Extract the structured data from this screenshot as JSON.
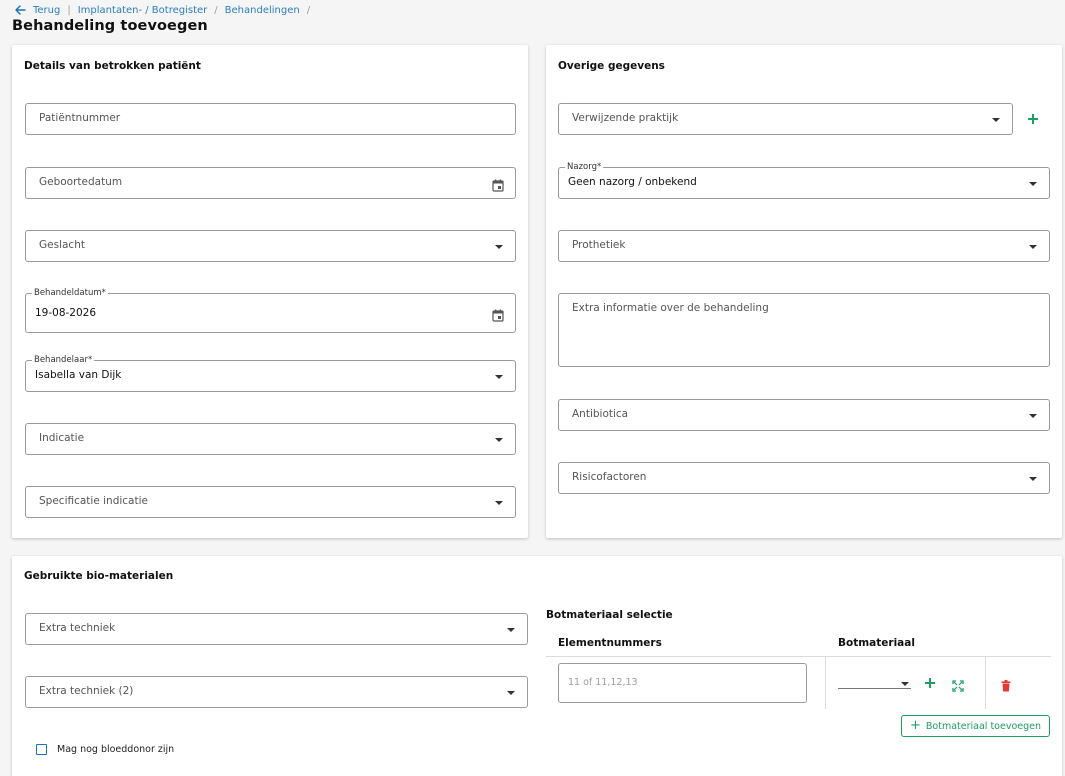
{
  "breadcrumb": {
    "back_label": "Terug",
    "items": [
      "Implantaten- / Botregister",
      "Behandelingen"
    ]
  },
  "page_title": "Behandeling toevoegen",
  "patient_card": {
    "title": "Details van betrokken patiënt",
    "patient_number_placeholder": "Patiëntnummer",
    "birthdate_placeholder": "Geboortedatum",
    "gender_placeholder": "Geslacht",
    "treatment_date_label": "Behandeldatum*",
    "treatment_date_value": "19-08-2026",
    "practitioner_label": "Behandelaar*",
    "practitioner_value": "Isabella van Dijk",
    "indication_placeholder": "Indicatie",
    "indication_spec_placeholder": "Specificatie indicatie"
  },
  "other_card": {
    "title": "Overige gegevens",
    "referring_practice_placeholder": "Verwijzende praktijk",
    "aftercare_label": "Nazorg*",
    "aftercare_value": "Geen nazorg / onbekend",
    "prosthetics_placeholder": "Prothetiek",
    "extra_info_placeholder": "Extra informatie over de behandeling",
    "antibiotics_placeholder": "Antibiotica",
    "risk_factors_placeholder": "Risicofactoren"
  },
  "bio_card": {
    "title": "Gebruikte bio-materialen",
    "extra_technique_placeholder": "Extra techniek",
    "extra_technique_2_placeholder": "Extra techniek (2)",
    "blood_donor_label": "Mag nog bloeddonor zijn",
    "blood_donor_checked": false,
    "bone_selection_title": "Botmateriaal selectie",
    "columns": [
      "Elementnummers",
      "Botmateriaal"
    ],
    "element_placeholder": "11 of 11,12,13",
    "add_bone_button": "Botmateriaal toevoegen"
  },
  "colors": {
    "accent_green": "#1e9e61",
    "link_blue": "#2a7fc1",
    "delete_red": "#e53935"
  }
}
